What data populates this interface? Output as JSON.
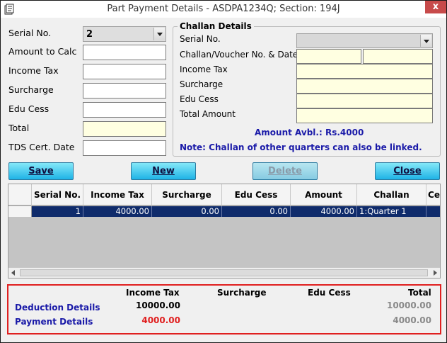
{
  "window": {
    "title": "Part Payment Details - ASDPA1234Q; Section: 194J",
    "close_label": "x"
  },
  "left_form": {
    "serial_label": "Serial No.",
    "serial_value": "2",
    "amount_label": "Amount to Calc",
    "income_tax_label": "Income Tax",
    "surcharge_label": "Surcharge",
    "edu_cess_label": "Edu Cess",
    "total_label": "Total",
    "tds_date_label": "TDS Cert. Date"
  },
  "challan": {
    "legend": "Challan Details",
    "serial_label": "Serial No.",
    "voucher_label": "Challan/Voucher No. & Date",
    "income_tax_label": "Income Tax",
    "surcharge_label": "Surcharge",
    "edu_cess_label": "Edu Cess",
    "total_label": "Total Amount",
    "amount_avbl": "Amount Avbl.: Rs.4000",
    "note": "Note: Challan of other quarters can also be linked."
  },
  "buttons": {
    "save": "Save",
    "new": "New",
    "delete": "Delete",
    "close": "Close"
  },
  "grid": {
    "columns": [
      "Serial No.",
      "Income Tax",
      "Surcharge",
      "Edu Cess",
      "Amount",
      "Challan",
      "Ce"
    ],
    "rows": [
      {
        "serial": "1",
        "income_tax": "4000.00",
        "surcharge": "0.00",
        "edu_cess": "0.00",
        "amount": "4000.00",
        "challan": "1:Quarter 1"
      }
    ]
  },
  "summary": {
    "headers": {
      "income_tax": "Income Tax",
      "surcharge": "Surcharge",
      "edu_cess": "Edu Cess",
      "total": "Total"
    },
    "deduction": {
      "label": "Deduction Details",
      "income_tax": "10000.00",
      "total": "10000.00"
    },
    "payment": {
      "label": "Payment Details",
      "income_tax": "4000.00",
      "total": "4000.00"
    }
  },
  "colors": {
    "accent_blue": "#1a1aa8",
    "highlight_red": "#e02020",
    "selected_row": "#0f2b6b",
    "button_cyan": "#1fb3e6",
    "field_yellow": "#ffffe1"
  }
}
